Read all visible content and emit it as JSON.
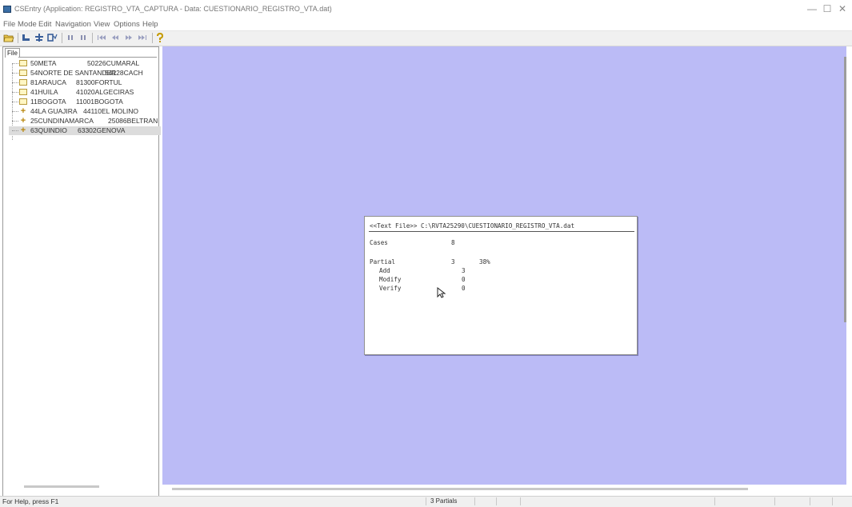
{
  "window": {
    "title": "CSEntry (Application: REGISTRO_VTA_CAPTURA - Data: CUESTIONARIO_REGISTRO_VTA.dat)",
    "controls": {
      "minimize": "—",
      "maximize": "☐",
      "close": "✕"
    }
  },
  "menu": [
    "File",
    "Mode",
    "Edit",
    "Navigation",
    "View",
    "Options",
    "Help"
  ],
  "toolbar": {
    "icons": [
      "open-icon",
      "add-case-icon",
      "modify-case-icon",
      "verify-case-icon",
      "pause-icon",
      "stop-icon",
      "first-icon",
      "previous-icon",
      "next-icon",
      "last-icon",
      "help-icon"
    ]
  },
  "tree": {
    "tab_label": "File",
    "items": [
      {
        "dept": "50META",
        "muni": "50226CUMARAL",
        "expand": false,
        "selected": false
      },
      {
        "dept": "54NORTE DE SANTANDER",
        "muni": "54128CACH",
        "expand": false,
        "selected": false
      },
      {
        "dept": "81ARAUCA",
        "muni": "81300FORTUL",
        "expand": false,
        "selected": false
      },
      {
        "dept": "41HUILA",
        "muni": "41020ALGECIRAS",
        "expand": false,
        "selected": false
      },
      {
        "dept": "11BOGOTA",
        "muni": "11001BOGOTA",
        "expand": false,
        "selected": false
      },
      {
        "dept": "44LA GUAJIRA",
        "muni": "44110EL MOLINO",
        "expand": true,
        "selected": false
      },
      {
        "dept": "25CUNDINAMARCA",
        "muni": "25086BELTRAN",
        "expand": true,
        "selected": false
      },
      {
        "dept": "63QUINDIO",
        "muni": "63302GENOVA",
        "expand": true,
        "selected": true
      }
    ]
  },
  "stats": {
    "header": "<<Text File>> C:\\RVTA25290\\CUESTIONARIO_REGISTRO_VTA.dat",
    "cases_label": "Cases",
    "cases_value": "8",
    "partial_label": "Partial",
    "partial_value": "3",
    "partial_pct": "38%",
    "add_label": "Add",
    "add_value": "3",
    "modify_label": "Modify",
    "modify_value": "0",
    "verify_label": "Verify",
    "verify_value": "0"
  },
  "status": {
    "help_text": "For Help, press F1",
    "partials_text": "3 Partials"
  },
  "colors": {
    "workspace": "#bbbbf6",
    "folder": "#fff6c4",
    "expand_plus": "#b8860b"
  }
}
